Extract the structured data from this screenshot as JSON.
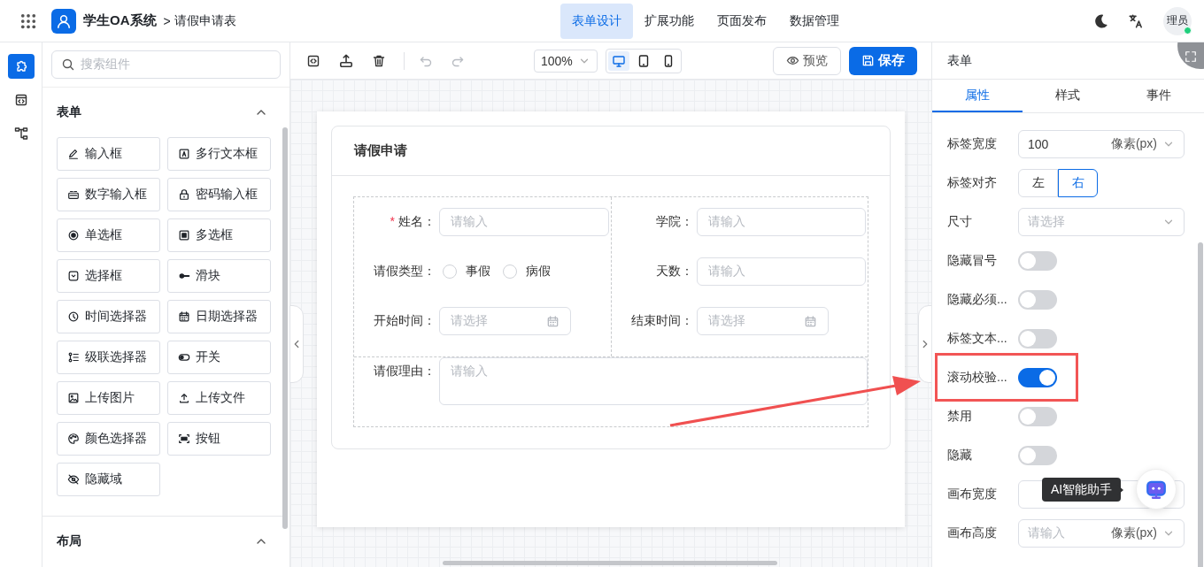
{
  "header": {
    "app_name": "学生OA系统",
    "breadcrumb_separator": ">",
    "breadcrumb": "请假申请表",
    "nav": [
      {
        "label": "表单设计",
        "selected": true
      },
      {
        "label": "扩展功能",
        "selected": false
      },
      {
        "label": "页面发布",
        "selected": false
      },
      {
        "label": "数据管理",
        "selected": false
      }
    ],
    "user": {
      "name": "理员",
      "online": true
    }
  },
  "rail": [
    {
      "kind": "components",
      "selected": true
    },
    {
      "kind": "code",
      "selected": false
    },
    {
      "kind": "tree",
      "selected": false
    }
  ],
  "component_panel": {
    "search_placeholder": "搜索组件",
    "sections": [
      {
        "title": "表单",
        "expanded": true,
        "items": [
          {
            "label": "输入框",
            "kind": "input"
          },
          {
            "label": "多行文本框",
            "kind": "textarea"
          },
          {
            "label": "数字输入框",
            "kind": "number"
          },
          {
            "label": "密码输入框",
            "kind": "password"
          },
          {
            "label": "单选框",
            "kind": "radio"
          },
          {
            "label": "多选框",
            "kind": "checkbox"
          },
          {
            "label": "选择框",
            "kind": "select"
          },
          {
            "label": "滑块",
            "kind": "slider"
          },
          {
            "label": "时间选择器",
            "kind": "time"
          },
          {
            "label": "日期选择器",
            "kind": "date"
          },
          {
            "label": "级联选择器",
            "kind": "cascader"
          },
          {
            "label": "开关",
            "kind": "switch"
          },
          {
            "label": "上传图片",
            "kind": "image"
          },
          {
            "label": "上传文件",
            "kind": "file"
          },
          {
            "label": "颜色选择器",
            "kind": "color"
          },
          {
            "label": "按钮",
            "kind": "button"
          },
          {
            "label": "隐藏域",
            "kind": "hidden"
          }
        ]
      },
      {
        "title": "布局",
        "expanded": true
      }
    ]
  },
  "toolbar": {
    "history": [
      {
        "kind": "undo",
        "disabled": true
      },
      {
        "kind": "redo",
        "disabled": true
      }
    ],
    "zoom": "100%",
    "devices": [
      {
        "kind": "desktop",
        "selected": true
      },
      {
        "kind": "tablet",
        "selected": false
      },
      {
        "kind": "phone",
        "selected": false
      }
    ],
    "preview": "预览",
    "save": "保存"
  },
  "form": {
    "title": "请假申请",
    "columns": [
      [
        {
          "label": "姓名：",
          "required_mark": "*",
          "kind": "input",
          "placeholder": "请输入"
        },
        {
          "label": "请假类型：",
          "kind": "radio",
          "options": [
            {
              "label": "事假",
              "selected": false
            },
            {
              "label": "病假",
              "selected": false
            }
          ]
        },
        {
          "label": "开始时间：",
          "kind": "date",
          "placeholder": "请选择"
        }
      ],
      [
        {
          "label": "学院：",
          "kind": "input",
          "placeholder": "请输入"
        },
        {
          "label": "天数：",
          "kind": "input",
          "placeholder": "请输入"
        },
        {
          "label": "结束时间：",
          "kind": "date",
          "placeholder": "请选择"
        }
      ]
    ],
    "full_row": [
      {
        "label": "请假理由：",
        "kind": "textarea",
        "placeholder": "请输入"
      }
    ]
  },
  "props_panel": {
    "title": "表单",
    "tabs": [
      {
        "label": "属性",
        "selected": true
      },
      {
        "label": "样式",
        "selected": false
      },
      {
        "label": "事件",
        "selected": false
      }
    ],
    "rows": [
      {
        "label": "标签宽度",
        "kind": "input-unit",
        "value": "100",
        "unit": "像素(px)"
      },
      {
        "label": "标签对齐",
        "kind": "segmented",
        "options": [
          {
            "label": "左",
            "selected": false
          },
          {
            "label": "右",
            "selected": true
          }
        ]
      },
      {
        "label": "尺寸",
        "kind": "select",
        "placeholder": "请选择"
      },
      {
        "label": "隐藏冒号",
        "kind": "switch",
        "on": false
      },
      {
        "label": "隐藏必须...",
        "kind": "switch",
        "on": false
      },
      {
        "label": "标签文本...",
        "kind": "switch",
        "on": false
      },
      {
        "label": "滚动校验...",
        "kind": "switch",
        "on": true,
        "annotated": true
      },
      {
        "label": "禁用",
        "kind": "switch",
        "on": false
      },
      {
        "label": "隐藏",
        "kind": "switch",
        "on": false
      },
      {
        "label": "画布宽度",
        "kind": "input-unit"
      },
      {
        "label": "画布高度",
        "kind": "input-unit",
        "placeholder": "请输入",
        "unit": "像素(px)"
      }
    ]
  },
  "assistant": {
    "label": "AI智能助手"
  }
}
